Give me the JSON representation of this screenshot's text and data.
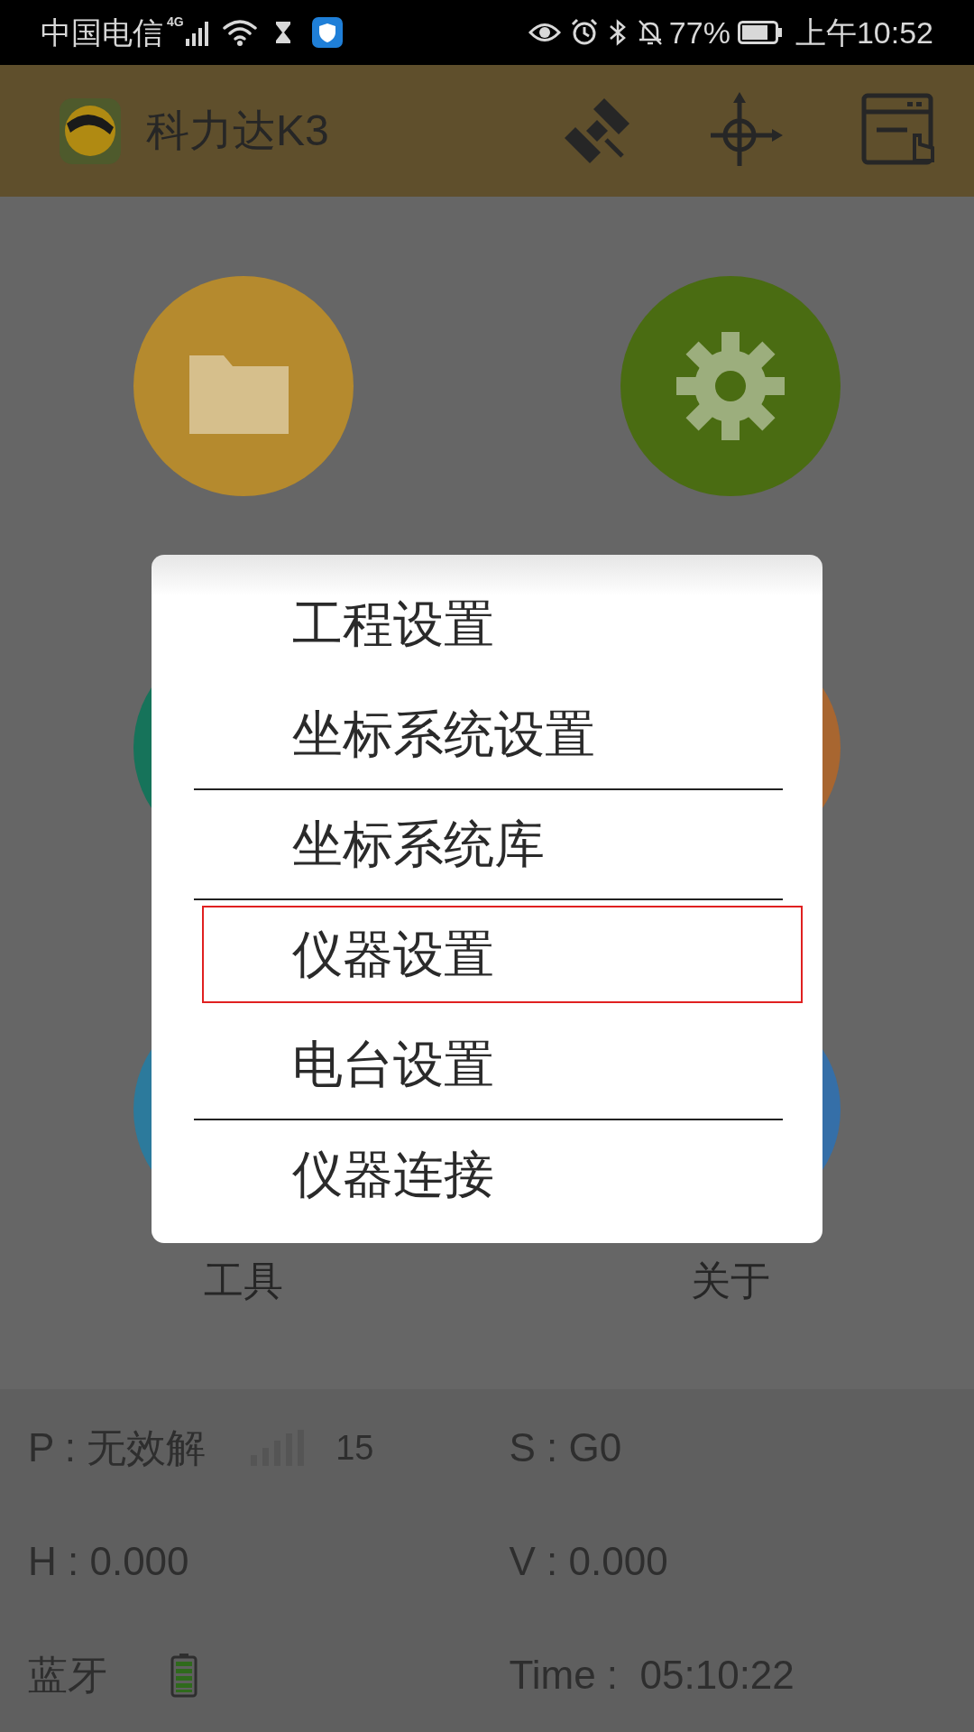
{
  "status_bar": {
    "carrier": "中国电信",
    "network": "4G",
    "battery": "77%",
    "time": "上午10:52"
  },
  "app_bar": {
    "title": "科力达K3"
  },
  "tiles": [
    {
      "color": "#b58a2e",
      "kind": "folder"
    },
    {
      "color": "#4a6c12",
      "kind": "gear"
    },
    {
      "color": "#16735a",
      "kind": "blank"
    },
    {
      "color": "#a86630",
      "kind": "blank"
    },
    {
      "label": "工具",
      "color": "#2c7a9c",
      "kind": "blank"
    },
    {
      "label": "关于",
      "color": "#356fa8",
      "kind": "blank"
    }
  ],
  "menu": [
    {
      "label": "工程设置",
      "selected": false,
      "separator_after": false
    },
    {
      "label": "坐标系统设置",
      "selected": false,
      "separator_after": true
    },
    {
      "label": "坐标系统库",
      "selected": false,
      "separator_after": true
    },
    {
      "label": "仪器设置",
      "selected": true,
      "separator_after": false
    },
    {
      "label": "电台设置",
      "selected": false,
      "separator_after": true
    },
    {
      "label": "仪器连接",
      "selected": false,
      "separator_after": false
    }
  ],
  "info": {
    "p": "P : 无效解",
    "sat_count": "15",
    "s": "S : G0",
    "h": "H : 0.000",
    "v": "V : 0.000",
    "bt": "蓝牙",
    "time": "Time :  05:10:22"
  }
}
